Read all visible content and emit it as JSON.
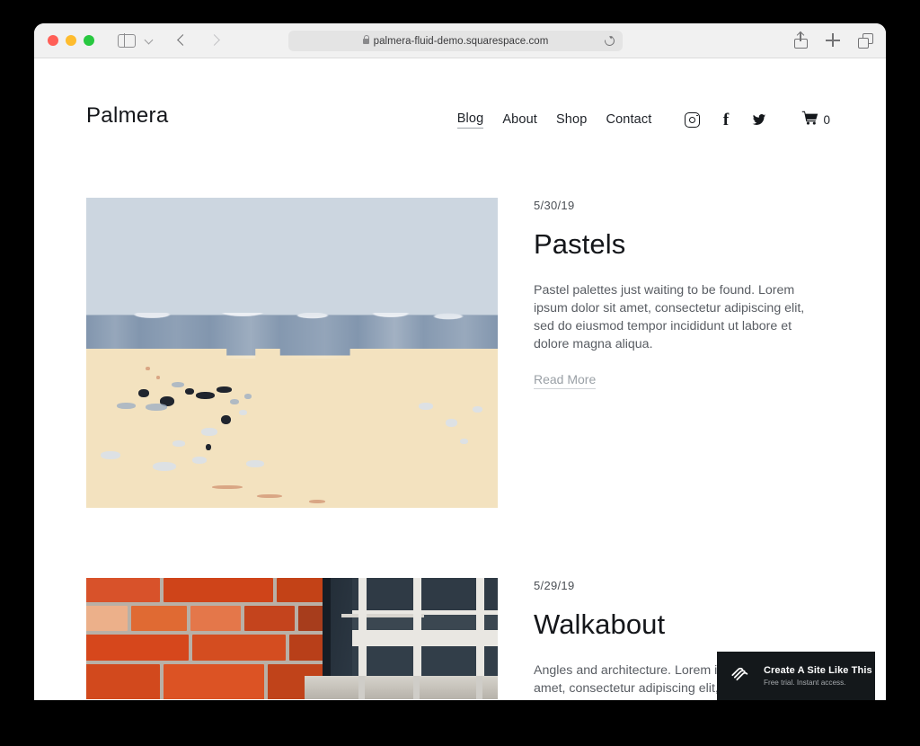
{
  "browser": {
    "url": "palmera-fluid-demo.squarespace.com",
    "lock_icon": "lock-icon",
    "reload_icon": "reload-icon",
    "sidebar_icon": "sidebar-toggle-icon",
    "chevron_icon": "chevron-down-icon",
    "back_icon": "back-arrow-icon",
    "forward_icon": "forward-arrow-icon",
    "share_icon": "share-icon",
    "new_tab_icon": "plus-icon",
    "tabs_icon": "tab-overview-icon"
  },
  "site": {
    "logo": "Palmera",
    "nav": [
      {
        "label": "Blog",
        "active": true
      },
      {
        "label": "About",
        "active": false
      },
      {
        "label": "Shop",
        "active": false
      },
      {
        "label": "Contact",
        "active": false
      }
    ],
    "social": [
      {
        "name": "instagram-icon"
      },
      {
        "name": "facebook-icon",
        "glyph": "f"
      },
      {
        "name": "twitter-icon"
      }
    ],
    "cart": {
      "icon": "shopping-cart-icon",
      "count": "0"
    }
  },
  "posts": [
    {
      "date": "5/30/19",
      "title": "Pastels",
      "excerpt": "Pastel palettes just waiting to be found. Lorem ipsum dolor sit amet, consectetur adipiscing elit, sed do eiusmod tempor incididunt ut labore et dolore magna aliqua.",
      "read_more": "Read More",
      "image_alt": "pastel-painted-wall-photo"
    },
    {
      "date": "5/29/19",
      "title": "Walkabout",
      "excerpt": "Angles and architecture. Lorem ipsum dolor sit amet, consectetur adipiscing elit, sed do eiusmod tempor incididunt ut labore et dolore magna aliqua.",
      "image_alt": "orange-brick-wall-and-window-photo"
    }
  ],
  "promo": {
    "logo_icon": "squarespace-logo-icon",
    "headline": "Create A Site Like This",
    "subtext": "Free trial. Instant access."
  },
  "colors": {
    "page_background": "#ffffff",
    "desktop_background": "#000000",
    "toolbar": "#f1f1f1",
    "text_primary": "#14161a",
    "text_muted": "#595d63",
    "link_muted": "#9aa0a6",
    "promo_background": "#14181b",
    "image1_sky": "#ccd6e0",
    "image1_band": "#8296ae",
    "image1_sand": "#f3e2bf",
    "image2_brick": "#d2491d",
    "image2_wall": "#2e3a46"
  }
}
